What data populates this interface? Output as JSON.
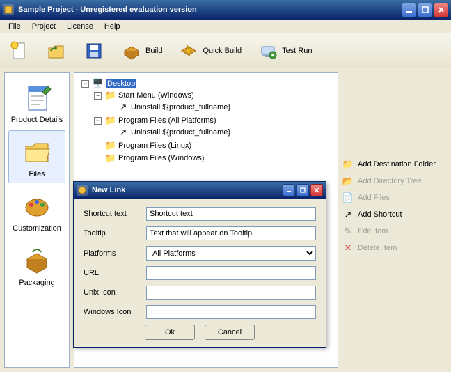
{
  "window": {
    "title": "Sample Project - Unregistered evaluation version"
  },
  "menu": {
    "items": [
      "File",
      "Project",
      "License",
      "Help"
    ]
  },
  "toolbar": {
    "new": "",
    "open": "",
    "save": "",
    "build": "Build",
    "quickbuild": "Quick Build",
    "testrun": "Test Run"
  },
  "sidebar": {
    "items": [
      {
        "label": "Product Details"
      },
      {
        "label": "Files"
      },
      {
        "label": "Customization"
      },
      {
        "label": "Packaging"
      }
    ],
    "selected": 1
  },
  "tree": {
    "root": "Desktop",
    "items": [
      "Start Menu (Windows)",
      "Uninstall ${product_fullname}",
      "Program Files (All Platforms)",
      "Uninstall ${product_fullname}",
      "Program Files (Linux)",
      "Program Files (Windows)"
    ]
  },
  "actions": {
    "addDest": "Add Destination Folder",
    "addTree": "Add Directory Tree",
    "addFiles": "Add Files",
    "addShortcut": "Add Shortcut",
    "editItem": "Edit Item",
    "deleteItem": "Delete Item"
  },
  "dialog": {
    "title": "New Link",
    "labels": {
      "shortcut": "Shortcut text",
      "tooltip": "Tooltip",
      "platforms": "Platforms",
      "url": "URL",
      "unixicon": "Unix Icon",
      "winicon": "Windows Icon"
    },
    "values": {
      "shortcut": "Shortcut text",
      "tooltip": "Text that will appear on Tooltip",
      "platforms": "All Platforms",
      "url": "",
      "unixicon": "",
      "winicon": ""
    },
    "buttons": {
      "ok": "Ok",
      "cancel": "Cancel"
    }
  }
}
